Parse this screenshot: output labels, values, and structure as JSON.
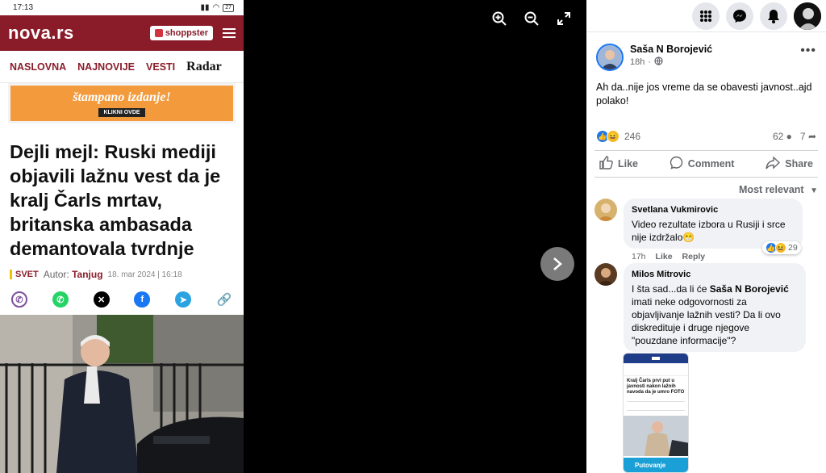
{
  "phone": {
    "status": {
      "time": "17:13",
      "battery": "27"
    },
    "logo": "nova.rs",
    "shoppster": "shoppster",
    "nav": [
      "NASLOVNA",
      "NAJNOVIJE",
      "VESTI"
    ],
    "nav_radar": "Radar",
    "ad": {
      "text": "štampano izdanje!",
      "button": "KLIKNI OVDE"
    },
    "headline": "Dejli mejl: Ruski mediji objavili lažnu vest da je kralj Čarls mrtav, britanska ambasada demantovala tvrdnje",
    "category": "SVET",
    "author_label": "Autor:",
    "author": "Tanjug",
    "date": "18. mar 2024 | 16:18"
  },
  "facebook": {
    "author": "Saša N Borojević",
    "time": "18h",
    "post_text": "Ah da..nije jos vreme da se obavesti javnost..ajd polako!",
    "reaction_count": "246",
    "comment_count": "62",
    "share_count": "7",
    "actions": {
      "like": "Like",
      "comment": "Comment",
      "share": "Share"
    },
    "sort_label": "Most relevant",
    "comments": [
      {
        "name": "Svetlana Vukmirovic",
        "text": "Video rezultate izbora u Rusiji i srce nije izdržalo😁",
        "time": "17h",
        "like": "Like",
        "reply": "Reply",
        "reactions": "29"
      },
      {
        "name": "Milos Mitrovic",
        "text_pre": "I šta sad...da li će ",
        "text_bold": "Saša N Borojević",
        "text_post": " imati neke odgovornosti za objavljivanje lažnih vesti? Da li ovo diskredituje i druge njegove \"pouzdane informacije\"?"
      }
    ],
    "thumbnail": {
      "headline": "Kralj Čarls prvi put u javnosti nakon lažnih navoda da je umro FOTO",
      "footer": "Putovanje"
    }
  }
}
